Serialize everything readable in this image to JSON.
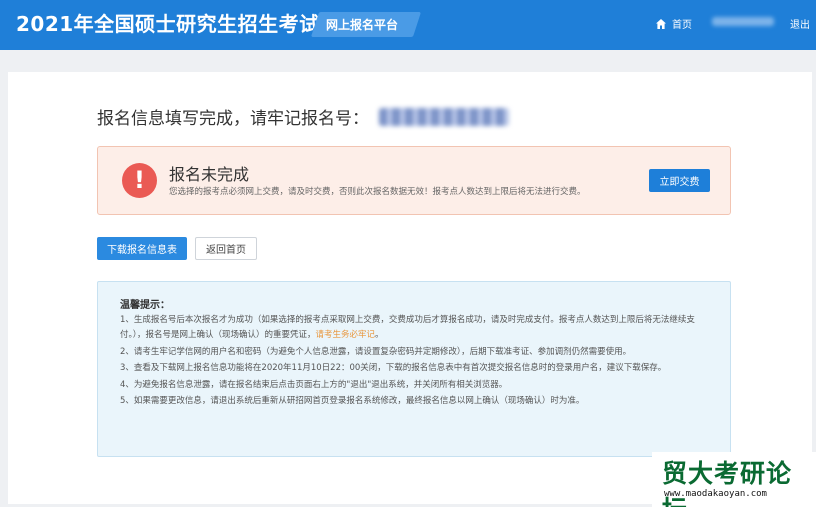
{
  "header": {
    "site_title": "2021年全国硕士研究生招生考试",
    "platform_tag": "网上报名平台",
    "home_label": "首页",
    "home_icon": "home-icon",
    "logout_label": "退出",
    "brand_color": "#1f7fd8"
  },
  "main": {
    "done_text": "报名信息填写完成，请牢记报名号："
  },
  "alert": {
    "icon": "exclamation-icon",
    "title": "报名未完成",
    "description": "您选择的报考点必须网上交费，请及时交费，否则此次报名数据无效！报考点人数达到上限后将无法进行交费。",
    "pay_button": "立即交费",
    "icon_color": "#ea5a54"
  },
  "actions": {
    "download_label": "下载报名信息表",
    "back_label": "返回首页"
  },
  "tips": {
    "title": "温馨提示：",
    "item1_part1": "1、生成报名号后本次报名才为成功（如果选择的报考点采取网上交费，交费成功后才算报名成功，请及时完成支付。报考点人数达到上限后将无法继续支付。），报名号是网上确认（现场确认）的重要凭证，",
    "item1_highlight": "请考生务必牢记",
    "item1_part2": "。",
    "item2": "2、请考生牢记学信网的用户名和密码（为避免个人信息泄露，请设置复杂密码并定期修改），后期下载准考证、参加调剂仍然需要使用。",
    "item3": "3、查看及下载网上报名信息功能将在2020年11月10日22：00关闭，下载的报名信息表中有首次提交报名信息时的登录用户名，建议下载保存。",
    "item4": "4、为避免报名信息泄露，请在报名结束后点击页面右上方的\"退出\"退出系统，并关闭所有相关浏览器。",
    "item5": "5、如果需要更改信息，请退出系统后重新从研招网首页登录报名系统修改，最终报名信息以网上确认（现场确认）时为准。",
    "highlight_color": "#e8963c"
  },
  "watermark": {
    "text": "贸大考研论坛",
    "url": "www.maodakaoyan.com"
  }
}
